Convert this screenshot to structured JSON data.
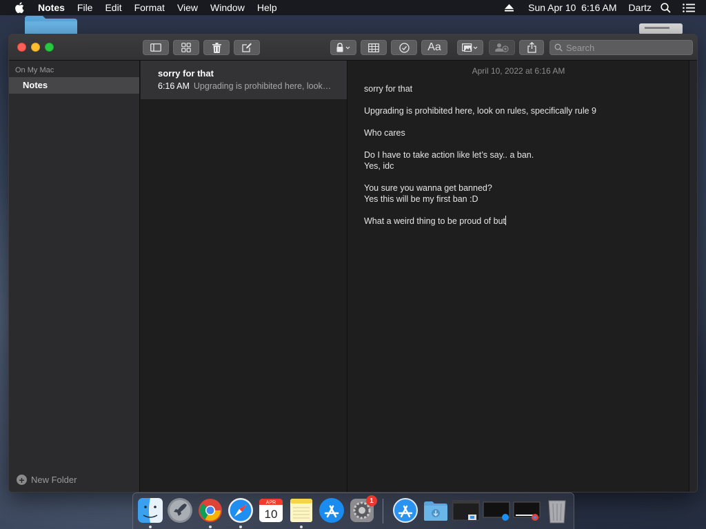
{
  "menubar": {
    "apple_icon": "apple-icon",
    "app_name": "Notes",
    "items": [
      "File",
      "Edit",
      "Format",
      "View",
      "Window",
      "Help"
    ],
    "clock": "Sun Apr 10  6:16 AM",
    "user": "Dartz",
    "right_icons": [
      "eject-icon",
      "search-icon",
      "list-icon"
    ]
  },
  "toolbar": {
    "buttons": [
      "sidebar-toggle-icon",
      "gallery-view-icon",
      "trash-icon",
      "compose-icon",
      "lock-icon",
      "table-icon",
      "checklist-icon",
      "format-text-icon",
      "media-icon",
      "collaborate-icon",
      "share-icon"
    ],
    "format_label": "Aa",
    "search_placeholder": "Search"
  },
  "sidebar": {
    "section_title": "On My Mac",
    "folders": [
      {
        "label": "Notes",
        "selected": true
      }
    ],
    "new_folder_label": "New Folder"
  },
  "notes_list": [
    {
      "title": "sorry for that",
      "time": "6:16 AM",
      "preview": "Upgrading is prohibited here, look…"
    }
  ],
  "editor": {
    "date": "April 10, 2022 at 6:16 AM",
    "lines": [
      "sorry for that",
      "",
      "Upgrading is prohibited here, look on rules, specifically rule 9",
      "",
      "Who cares",
      "",
      "Do I have to take action like let’s say.. a ban.",
      "Yes, idc",
      "",
      "You sure you wanna get banned?",
      "Yes this will be my first ban :D",
      "",
      "What a weird thing to be proud of but"
    ]
  },
  "dock": {
    "apps": [
      "finder-icon",
      "launchpad-icon",
      "chrome-icon",
      "safari-icon",
      "calendar-icon",
      "notes-icon",
      "app-store-icon",
      "system-preferences-icon",
      "app-store-folder-icon",
      "downloads-folder-icon",
      "window-thumbnail-icon",
      "window-thumbnail-icon",
      "window-thumbnail-icon",
      "trash-icon"
    ],
    "calendar_month": "APR",
    "calendar_day": "10",
    "sys_prefs_badge": "1"
  },
  "colors": {
    "accent_red": "#fe5f57",
    "accent_yellow": "#febc2e",
    "accent_green": "#28c840",
    "window_bg": "#1e1e1e",
    "sidebar_bg": "#2b2b2d"
  }
}
